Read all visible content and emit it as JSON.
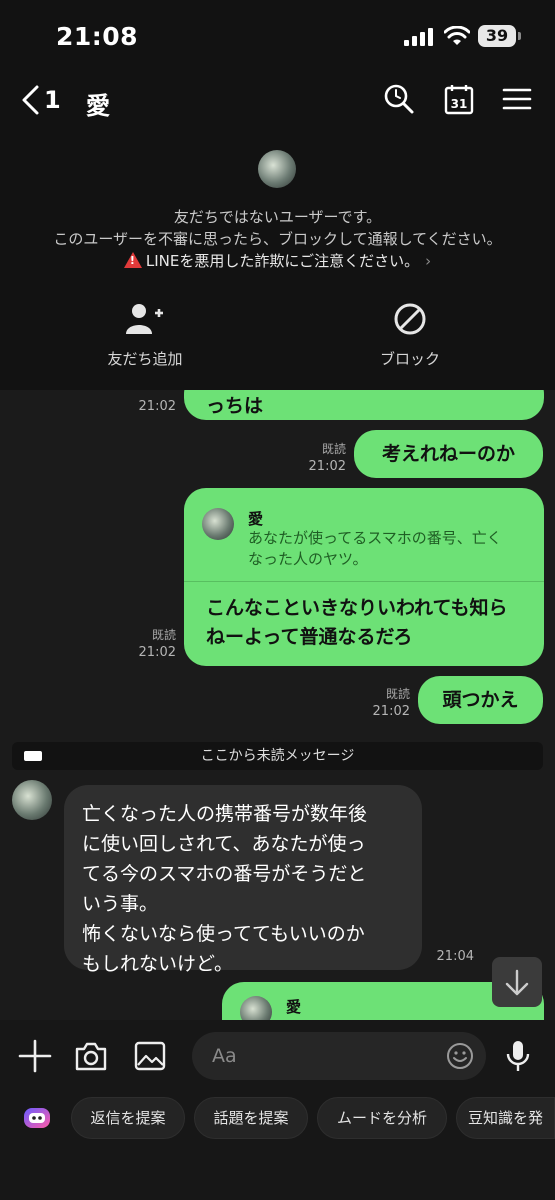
{
  "status_bar": {
    "time": "21:08",
    "battery": "39"
  },
  "header": {
    "back_count": "1",
    "title": "愛"
  },
  "stranger_panel": {
    "line1": "友だちではないユーザーです。",
    "line2": "このユーザーを不審に思ったら、ブロックして通報してください。",
    "warning": "LINEを悪用した詐欺にご注意ください。",
    "add_friend_label": "友だち追加",
    "block_label": "ブロック"
  },
  "messages": [
    {
      "text": "っちは",
      "time": "21:02"
    },
    {
      "text": "考えれねーのか",
      "read": "既読",
      "time": "21:02"
    },
    {
      "reply_name": "愛",
      "reply_text": "あなたが使ってるスマホの番号、亡くなった人のヤツ。",
      "text": "こんなこといきなりいわれても知らねーよって普通なるだろ",
      "read": "既読",
      "time": "21:02"
    },
    {
      "text": "頭つかえ",
      "read": "既読",
      "time": "21:02"
    }
  ],
  "unread_divider": "ここから未読メッセージ",
  "incoming": {
    "text": "亡くなった人の携帯番号が数年後\nに使い回しされて、あなたが使っ\nてる今のスマホの番号がそうだと\nいう事。\n怖くないなら使っててもいいのか\nもしれないけど。",
    "time": "21:04"
  },
  "peek": {
    "reply_name": "愛"
  },
  "input": {
    "placeholder": "Aa"
  },
  "chips": [
    "返信を提案",
    "話題を提案",
    "ムードを分析",
    "豆知識を発"
  ]
}
